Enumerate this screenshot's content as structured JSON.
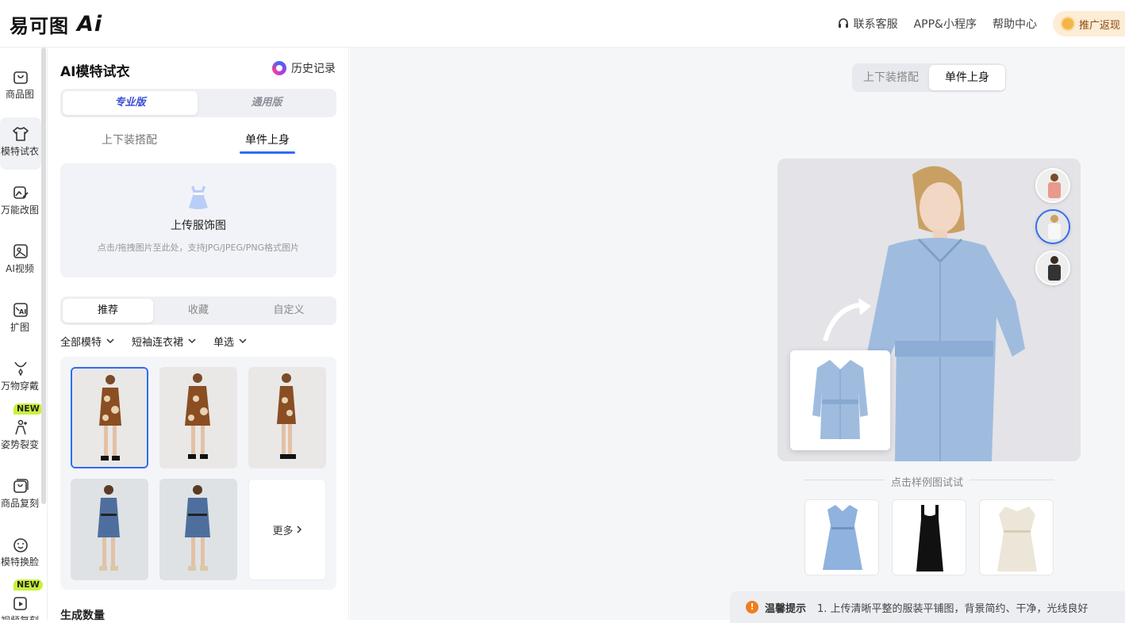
{
  "brand": {
    "logo_text": "易可图",
    "logo_ai": "Ai"
  },
  "topnav": {
    "service": "联系客服",
    "app": "APP&小程序",
    "help": "帮助中心",
    "promo": "推广返现"
  },
  "rail": {
    "items": [
      {
        "label": "商品图"
      },
      {
        "label": "模特试衣"
      },
      {
        "label": "万能改图"
      },
      {
        "label": "AI视频"
      },
      {
        "label": "扩图"
      },
      {
        "label": "万物穿戴"
      },
      {
        "label": "姿势裂变"
      },
      {
        "label": "商品复刻"
      },
      {
        "label": "模特换脸"
      },
      {
        "label": "视频复刻"
      }
    ],
    "new_badge": "NEW"
  },
  "panel": {
    "title": "AI模特试衣",
    "history": "历史记录",
    "version_pro": "专业版",
    "version_general": "通用版",
    "mode_combo": "上下装搭配",
    "mode_single": "单件上身",
    "upload_title": "上传服饰图",
    "upload_hint": "点击/拖拽图片至此处，支持JPG/JPEG/PNG格式图片",
    "tab_recommend": "推荐",
    "tab_favorite": "收藏",
    "tab_custom": "自定义",
    "filter_model": "全部模特",
    "filter_category": "短袖连衣裙",
    "filter_select": "单选",
    "more": "更多",
    "gen_count": "生成数量"
  },
  "main": {
    "seg_combo": "上下装搭配",
    "seg_single": "单件上身",
    "sample_label": "点击样例图试试",
    "tips_title": "温馨提示",
    "tips_text": "1. 上传清晰平整的服装平铺图，背景简约、干净，光线良好"
  },
  "colors": {
    "accent": "#2f6cf6",
    "new_badge": "#c9f23a",
    "promo_bg": "#fdecd6",
    "warn": "#f07d1a"
  }
}
